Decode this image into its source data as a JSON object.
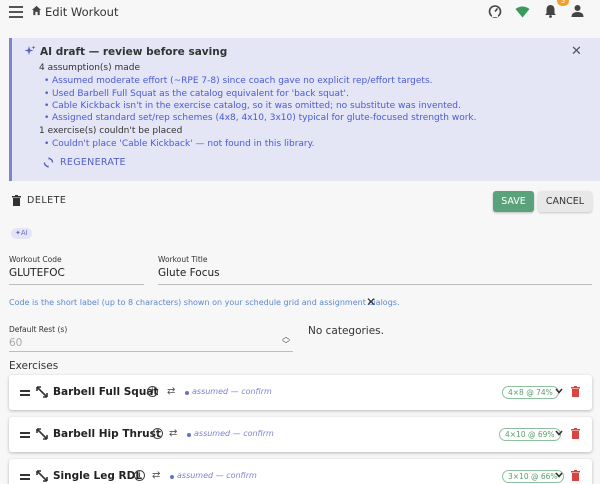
{
  "header": {
    "title": "Edit Workout",
    "notification_count": "5"
  },
  "ai_draft": {
    "title": "AI draft — review before saving",
    "assumptions_heading": "4 assumption(s) made",
    "assumptions": [
      "Assumed moderate effort (~RPE 7-8) since coach gave no explicit rep/effort targets.",
      "Used Barbell Full Squat as the catalog equivalent for 'back squat'.",
      "Cable Kickback isn't in the exercise catalog, so it was omitted; no substitute was invented.",
      "Assigned standard set/rep schemes (4x8, 4x10, 3x10) typical for glute-focused strength work."
    ],
    "unplaced_heading": "1 exercise(s) couldn't be placed",
    "unplaced": [
      "Couldn't place 'Cable Kickback' — not found in this library."
    ],
    "regenerate_label": "REGENERATE"
  },
  "toolbar": {
    "delete_label": "DELETE",
    "save_label": "SAVE",
    "cancel_label": "CANCEL"
  },
  "ai_chip": "AI",
  "form": {
    "code_label": "Workout Code",
    "code_value": "GLUTEFOC",
    "title_label": "Workout Title",
    "title_value": "Glute Focus",
    "code_hint": "Code is the short label (up to 8 characters) shown on your schedule grid and assignment dialogs.",
    "rest_label": "Default Rest (s)",
    "rest_value": "60",
    "categories_text": "No categories."
  },
  "exercises": {
    "heading": "Exercises",
    "items": [
      {
        "name": "Barbell Full Squat",
        "status": "assumed — confirm",
        "scheme": "4×8 @ 74%"
      },
      {
        "name": "Barbell Hip Thrust",
        "status": "assumed — confirm",
        "scheme": "4×10 @ 69%"
      },
      {
        "name": "Single Leg RDL",
        "status": "assumed — confirm",
        "scheme": "3×10 @ 66%"
      }
    ]
  },
  "colors": {
    "accent": "#5460c8",
    "save": "#5aa37a",
    "delete": "#d64541",
    "pill": "#8bc29d"
  }
}
